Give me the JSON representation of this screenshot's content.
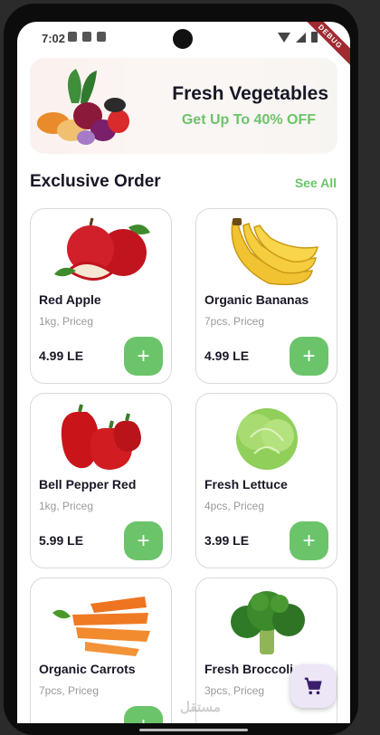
{
  "status_bar": {
    "time": "7:02",
    "debug_label": "DEBUG"
  },
  "banner": {
    "title": "Fresh Vegetables",
    "subtitle": "Get Up To 40% OFF"
  },
  "section": {
    "title": "Exclusive Order",
    "see_all": "See All"
  },
  "products": [
    {
      "name": "Red Apple",
      "detail": "1kg, Priceg",
      "price": "4.99 LE",
      "icon": "red-apple-image"
    },
    {
      "name": "Organic Bananas",
      "detail": "7pcs, Priceg",
      "price": "4.99 LE",
      "icon": "bananas-image"
    },
    {
      "name": "Bell Pepper Red",
      "detail": "1kg, Priceg",
      "price": "5.99 LE",
      "icon": "bell-pepper-image"
    },
    {
      "name": "Fresh Lettuce",
      "detail": "4pcs, Priceg",
      "price": "3.99 LE",
      "icon": "lettuce-image"
    },
    {
      "name": "Organic Carrots",
      "detail": "7pcs, Priceg",
      "price": "",
      "icon": "carrots-image"
    },
    {
      "name": "Fresh Broccoli",
      "detail": "3pcs, Priceg",
      "price": "",
      "icon": "broccoli-image"
    }
  ],
  "add_button_label": "+",
  "fab": {
    "icon": "cart-icon"
  },
  "watermark": "مستقل",
  "colors": {
    "accent": "#6CC46A",
    "text": "#181725",
    "muted": "#9A9A9A",
    "fab_bg": "#ECE6F7",
    "fab_icon": "#3A1F6B"
  }
}
